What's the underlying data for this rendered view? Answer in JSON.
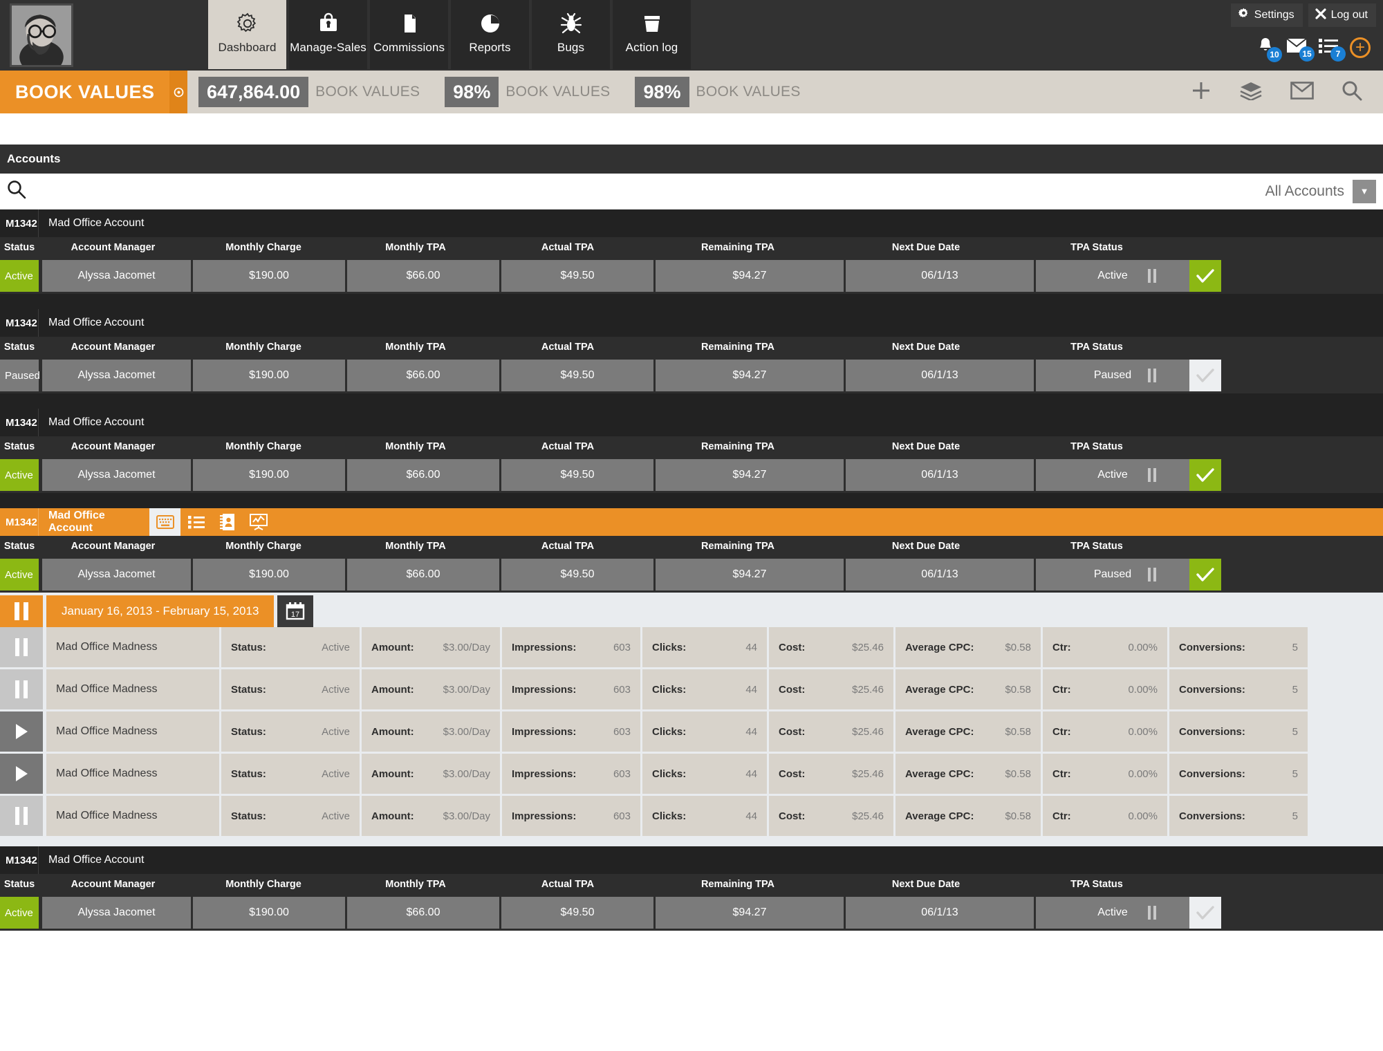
{
  "nav": {
    "tabs": [
      {
        "label": "Dashboard",
        "icon": "gear-icon",
        "active": true
      },
      {
        "label": "Manage-Sales",
        "icon": "briefcase-lock-icon",
        "active": false
      },
      {
        "label": "Commissions",
        "icon": "document-icon",
        "active": false
      },
      {
        "label": "Reports",
        "icon": "pie-chart-icon",
        "active": false
      },
      {
        "label": "Bugs",
        "icon": "bug-icon",
        "active": false
      },
      {
        "label": "Action log",
        "icon": "folder-icon",
        "active": false
      }
    ],
    "settings_label": "Settings",
    "logout_label": "Log out",
    "notifications": [
      {
        "icon": "bell-icon",
        "count": "10"
      },
      {
        "icon": "envelope-icon",
        "count": "15"
      },
      {
        "icon": "list-icon",
        "count": "7"
      }
    ],
    "add_label": "+",
    "accent_orange": "#eb9026",
    "badge_blue": "#1a7fd4"
  },
  "bookvalues": {
    "title": "BOOK VALUES",
    "metrics": [
      {
        "value": "647,864.00",
        "label": "BOOK VALUES"
      },
      {
        "value": "98%",
        "label": "BOOK VALUES"
      },
      {
        "value": "98%",
        "label": "BOOK VALUES"
      }
    ],
    "actions": [
      "plus-icon",
      "layers-icon",
      "mail-icon",
      "search-icon"
    ]
  },
  "accounts": {
    "section_title": "Accounts",
    "search_placeholder": "",
    "filter_value": "All Accounts",
    "columns": [
      "Status",
      "Account Manager",
      "Monthly Charge",
      "Monthly TPA",
      "Actual TPA",
      "Remaining TPA",
      "Next Due Date",
      "TPA Status"
    ],
    "rows": [
      {
        "id": "M1342",
        "name": "Mad Office Account",
        "selected": false,
        "status": "Active",
        "status_active": true,
        "manager": "Alyssa Jacomet",
        "monthly_charge": "$190.00",
        "monthly_tpa": "$66.00",
        "actual_tpa": "$49.50",
        "remaining_tpa": "$94.27",
        "next_due": "06/1/13",
        "tpa_status": "Active",
        "check_on": true
      },
      {
        "id": "M1342",
        "name": "Mad Office Account",
        "selected": false,
        "status": "Paused",
        "status_active": false,
        "manager": "Alyssa Jacomet",
        "monthly_charge": "$190.00",
        "monthly_tpa": "$66.00",
        "actual_tpa": "$49.50",
        "remaining_tpa": "$94.27",
        "next_due": "06/1/13",
        "tpa_status": "Paused",
        "check_on": false
      },
      {
        "id": "M1342",
        "name": "Mad Office Account",
        "selected": false,
        "status": "Active",
        "status_active": true,
        "manager": "Alyssa Jacomet",
        "monthly_charge": "$190.00",
        "monthly_tpa": "$66.00",
        "actual_tpa": "$49.50",
        "remaining_tpa": "$94.27",
        "next_due": "06/1/13",
        "tpa_status": "Active",
        "check_on": true
      },
      {
        "id": "M1342",
        "name": "Mad Office Account",
        "selected": true,
        "status": "Active",
        "status_active": true,
        "manager": "Alyssa Jacomet",
        "monthly_charge": "$190.00",
        "monthly_tpa": "$66.00",
        "actual_tpa": "$49.50",
        "remaining_tpa": "$94.27",
        "next_due": "06/1/13",
        "tpa_status": "Paused",
        "check_on": true
      },
      {
        "id": "M1342",
        "name": "Mad Office Account",
        "selected": false,
        "status": "Active",
        "status_active": true,
        "manager": "Alyssa Jacomet",
        "monthly_charge": "$190.00",
        "monthly_tpa": "$66.00",
        "actual_tpa": "$49.50",
        "remaining_tpa": "$94.27",
        "next_due": "06/1/13",
        "tpa_status": "Active",
        "check_on": false
      }
    ],
    "row_icons": [
      "keyboard-icon",
      "bullet-list-icon",
      "address-book-icon",
      "analytics-icon"
    ]
  },
  "panel": {
    "date_range": "January 16, 2013 - February 15, 2013",
    "calendar_day": "17",
    "campaigns": [
      {
        "control": "pause",
        "name": "Mad Office Madness",
        "status_k": "Status:",
        "status_v": "Active",
        "amount_k": "Amount:",
        "amount_v": "$3.00/Day",
        "impressions_k": "Impressions:",
        "impressions_v": "603",
        "clicks_k": "Clicks:",
        "clicks_v": "44",
        "cost_k": "Cost:",
        "cost_v": "$25.46",
        "cpc_k": "Average CPC:",
        "cpc_v": "$0.58",
        "ctr_k": "Ctr:",
        "ctr_v": "0.00%",
        "conv_k": "Conversions:",
        "conv_v": "5"
      },
      {
        "control": "pause",
        "name": "Mad Office Madness",
        "status_k": "Status:",
        "status_v": "Active",
        "amount_k": "Amount:",
        "amount_v": "$3.00/Day",
        "impressions_k": "Impressions:",
        "impressions_v": "603",
        "clicks_k": "Clicks:",
        "clicks_v": "44",
        "cost_k": "Cost:",
        "cost_v": "$25.46",
        "cpc_k": "Average CPC:",
        "cpc_v": "$0.58",
        "ctr_k": "Ctr:",
        "ctr_v": "0.00%",
        "conv_k": "Conversions:",
        "conv_v": "5"
      },
      {
        "control": "play",
        "name": "Mad Office Madness",
        "status_k": "Status:",
        "status_v": "Active",
        "amount_k": "Amount:",
        "amount_v": "$3.00/Day",
        "impressions_k": "Impressions:",
        "impressions_v": "603",
        "clicks_k": "Clicks:",
        "clicks_v": "44",
        "cost_k": "Cost:",
        "cost_v": "$25.46",
        "cpc_k": "Average CPC:",
        "cpc_v": "$0.58",
        "ctr_k": "Ctr:",
        "ctr_v": "0.00%",
        "conv_k": "Conversions:",
        "conv_v": "5"
      },
      {
        "control": "play",
        "name": "Mad Office Madness",
        "status_k": "Status:",
        "status_v": "Active",
        "amount_k": "Amount:",
        "amount_v": "$3.00/Day",
        "impressions_k": "Impressions:",
        "impressions_v": "603",
        "clicks_k": "Clicks:",
        "clicks_v": "44",
        "cost_k": "Cost:",
        "cost_v": "$25.46",
        "cpc_k": "Average CPC:",
        "cpc_v": "$0.58",
        "ctr_k": "Ctr:",
        "ctr_v": "0.00%",
        "conv_k": "Conversions:",
        "conv_v": "5"
      },
      {
        "control": "pause",
        "name": "Mad Office Madness",
        "status_k": "Status:",
        "status_v": "Active",
        "amount_k": "Amount:",
        "amount_v": "$3.00/Day",
        "impressions_k": "Impressions:",
        "impressions_v": "603",
        "clicks_k": "Clicks:",
        "clicks_v": "44",
        "cost_k": "Cost:",
        "cost_v": "$25.46",
        "cpc_k": "Average CPC:",
        "cpc_v": "$0.58",
        "ctr_k": "Ctr:",
        "ctr_v": "0.00%",
        "conv_k": "Conversions:",
        "conv_v": "5"
      }
    ]
  }
}
